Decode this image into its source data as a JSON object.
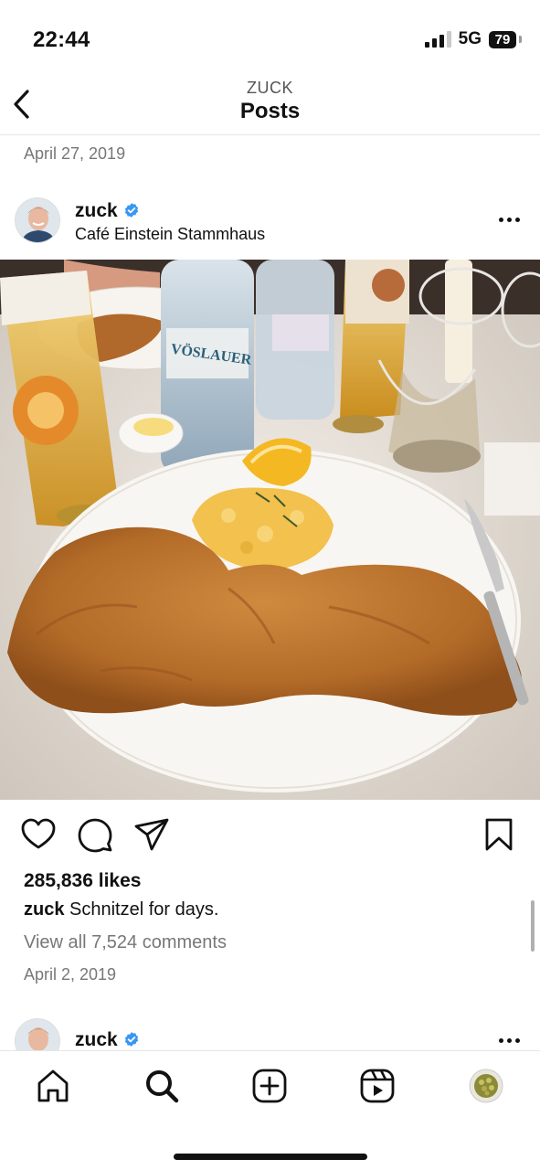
{
  "status": {
    "time": "22:44",
    "network": "5G",
    "battery": "79"
  },
  "header": {
    "subtitle": "ZUCK",
    "title": "Posts"
  },
  "previous_post": {
    "date": "April 27, 2019"
  },
  "post": {
    "username": "zuck",
    "location": "Café Einstein Stammhaus",
    "likes": "285,836 likes",
    "caption_user": "zuck",
    "caption_text": "Schnitzel for days.",
    "comments_link": "View all 7,524 comments",
    "date": "April 2, 2019",
    "photo_bottle_label": "VÖSLAUER"
  },
  "next_post": {
    "username": "zuck"
  },
  "icons": {
    "back": "chevron-left-icon",
    "verified": "verified-badge-icon",
    "more": "more-horizontal-icon",
    "like": "heart-icon",
    "comment": "comment-icon",
    "share": "send-icon",
    "save": "bookmark-icon",
    "tabs": [
      "home-icon",
      "search-icon",
      "create-icon",
      "reels-icon",
      "profile-avatar"
    ]
  },
  "colors": {
    "verified": "#3897F0",
    "text": "#111111",
    "muted": "#777777"
  }
}
